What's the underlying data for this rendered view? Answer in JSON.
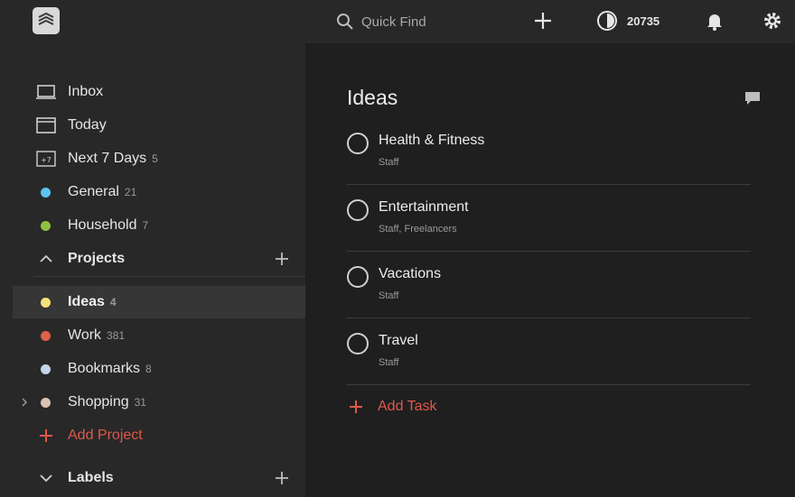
{
  "topbar": {
    "search_label": "Quick Find",
    "karma_count": "20735"
  },
  "sidebar": {
    "filters": [
      {
        "label": "Inbox",
        "count": ""
      },
      {
        "label": "Today",
        "count": ""
      },
      {
        "label": "Next 7 Days",
        "count": "5",
        "icon_text": "+7"
      },
      {
        "label": "General",
        "count": "21",
        "color": "#5bc4f0"
      },
      {
        "label": "Household",
        "count": "7",
        "color": "#8fc13e"
      }
    ],
    "projects_header": "Projects",
    "projects": [
      {
        "label": "Ideas",
        "count": "4",
        "color": "#f6e27a",
        "active": true
      },
      {
        "label": "Work",
        "count": "381",
        "color": "#e0614a"
      },
      {
        "label": "Bookmarks",
        "count": "8",
        "color": "#c5d4ea"
      },
      {
        "label": "Shopping",
        "count": "31",
        "color": "#d9c3b3"
      }
    ],
    "add_project_label": "Add Project",
    "labels_header": "Labels"
  },
  "main": {
    "title": "Ideas",
    "tasks": [
      {
        "name": "Health & Fitness",
        "labels": "Staff"
      },
      {
        "name": "Entertainment",
        "labels": "Staff, Freelancers"
      },
      {
        "name": "Vacations",
        "labels": "Staff"
      },
      {
        "name": "Travel",
        "labels": "Staff"
      }
    ],
    "add_task_label": "Add Task"
  },
  "colors": {
    "accent": "#e0584a",
    "topbar_bg": "#282828",
    "sidebar_bg": "#282828",
    "main_bg": "#1f1f1f",
    "active_row": "#363636"
  }
}
